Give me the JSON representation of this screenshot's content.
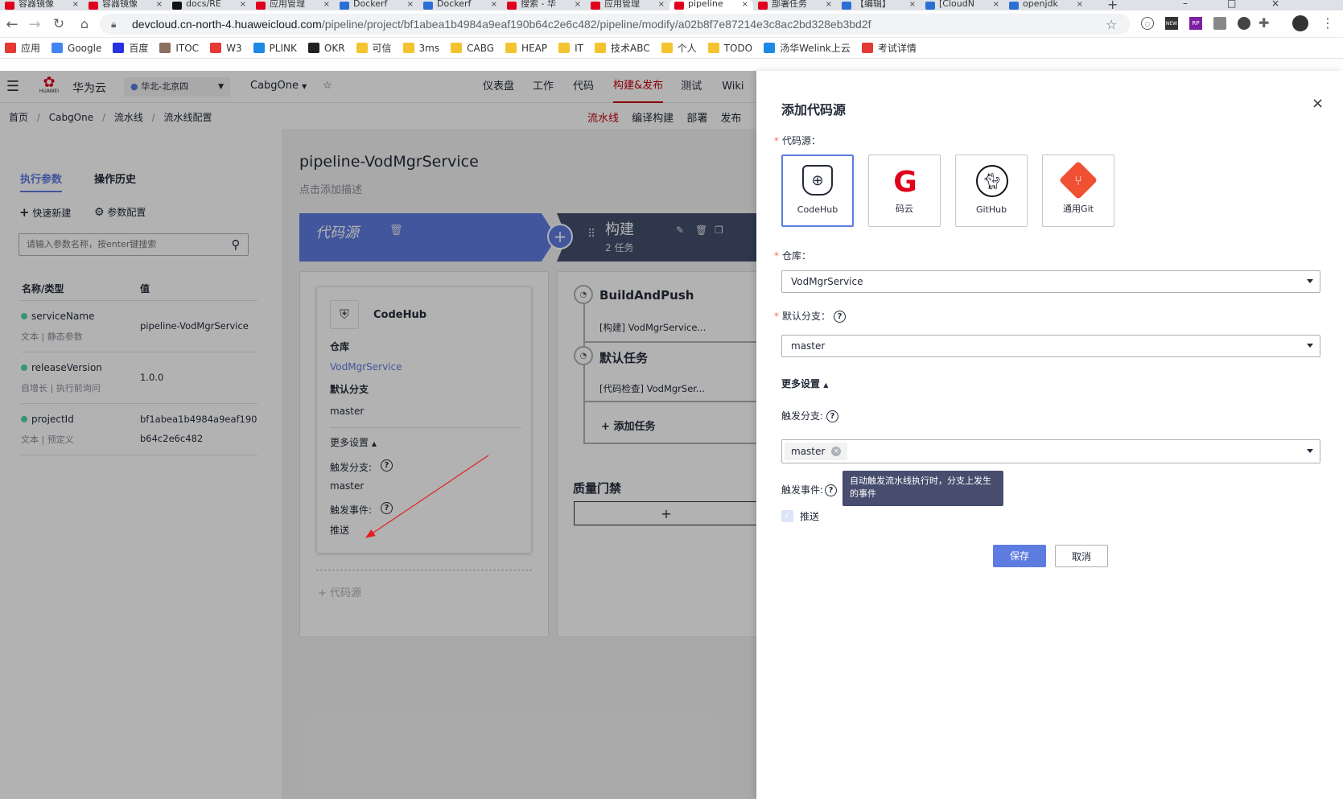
{
  "browser": {
    "tabs": [
      {
        "title": "容器镜像",
        "color": "#e0001b"
      },
      {
        "title": "容器镜像",
        "color": "#e0001b"
      },
      {
        "title": "docs/RE",
        "color": "#111111"
      },
      {
        "title": "应用管理",
        "color": "#e0001b"
      },
      {
        "title": "Dockerf",
        "color": "#2b6fd6"
      },
      {
        "title": "Dockerf",
        "color": "#2b6fd6"
      },
      {
        "title": "搜索 - 华",
        "color": "#e0001b"
      },
      {
        "title": "应用管理",
        "color": "#e0001b"
      },
      {
        "title": "pipeline",
        "color": "#e0001b"
      },
      {
        "title": "部署任务",
        "color": "#e0001b"
      },
      {
        "title": "【编辑】",
        "color": "#2b6fd6"
      },
      {
        "title": "[CloudN",
        "color": "#2b6fd6"
      },
      {
        "title": "openjdk",
        "color": "#2b6fd6"
      }
    ],
    "url_host": "devcloud.cn-north-4.huaweicloud.com",
    "url_path": "/pipeline/project/bf1abea1b4984a9eaf190b64c2e6c482/pipeline/modify/a02b8f7e87214e3c8ac2bd328eb3bd2f",
    "bookmarks": [
      {
        "label": "应用",
        "color": "#e53935"
      },
      {
        "label": "Google",
        "color": "#4285f4"
      },
      {
        "label": "百度",
        "color": "#2932e1"
      },
      {
        "label": "ITOC",
        "color": "#8d6e63"
      },
      {
        "label": "W3",
        "color": "#e53935"
      },
      {
        "label": "PLINK",
        "color": "#1e88e5"
      },
      {
        "label": "OKR",
        "color": "#212121"
      },
      {
        "label": "可信",
        "color": "#f4c430"
      },
      {
        "label": "3ms",
        "color": "#f4c430"
      },
      {
        "label": "CABG",
        "color": "#f4c430"
      },
      {
        "label": "HEAP",
        "color": "#f4c430"
      },
      {
        "label": "IT",
        "color": "#f4c430"
      },
      {
        "label": "技术ABC",
        "color": "#f4c430"
      },
      {
        "label": "个人",
        "color": "#f4c430"
      },
      {
        "label": "TODO",
        "color": "#f4c430"
      },
      {
        "label": "汤华Welink上云",
        "color": "#1e88e5"
      },
      {
        "label": "考试详情",
        "color": "#e53935"
      }
    ]
  },
  "app": {
    "brand": "华为云",
    "logo_text": "HUAWEI",
    "region": "华北-北京四",
    "project": "CabgOne",
    "nav": [
      "仪表盘",
      "工作",
      "代码",
      "构建&发布",
      "测试",
      "Wiki"
    ],
    "breadcrumb": [
      "首页",
      "CabgOne",
      "流水线",
      "流水线配置"
    ],
    "subnav": [
      "流水线",
      "编译构建",
      "部署",
      "发布"
    ]
  },
  "left": {
    "tabs": [
      "执行参数",
      "操作历史"
    ],
    "quick_new": "快速新建",
    "param_config": "参数配置",
    "search_placeholder": "请输入参数名称，按enter键搜索",
    "col_name": "名称/类型",
    "col_value": "值",
    "params": [
      {
        "name": "serviceName",
        "type": "文本 | 静态参数",
        "value": "pipeline-VodMgrService"
      },
      {
        "name": "releaseVersion",
        "type": "自增长 | 执行前询问",
        "value": "1.0.0"
      },
      {
        "name": "projectId",
        "type": "文本 | 预定义",
        "value": "bf1abea1b4984a9eaf190",
        "value2": "b64c2e6c482"
      }
    ]
  },
  "pipeline": {
    "title": "pipeline-VodMgrService",
    "desc": "点击添加描述",
    "stage1": "代码源",
    "stage2": "构建",
    "stage2_count": "2 任务",
    "source_card": {
      "title": "CodeHub",
      "repo_label": "仓库",
      "repo": "VodMgrService",
      "branch_label": "默认分支",
      "branch": "master",
      "more": "更多设置",
      "trigger_branch_label": "触发分支:",
      "trigger_branch": "master",
      "trigger_event_label": "触发事件:",
      "trigger_event": "推送"
    },
    "add_source": "代码源",
    "jobs": [
      {
        "name": "BuildAndPush",
        "task": "[构建] VodMgrService..."
      },
      {
        "name": "默认任务",
        "task": "[代码检查] VodMgrSer..."
      }
    ],
    "add_task": "添加任务",
    "quality_gate": "质量门禁"
  },
  "drawer": {
    "title": "添加代码源",
    "source_label": "代码源：",
    "sources": [
      "CodeHub",
      "码云",
      "GitHub",
      "通用Git"
    ],
    "repo_label": "仓库：",
    "repo_value": "VodMgrService",
    "branch_label": "默认分支：",
    "branch_value": "master",
    "more_settings": "更多设置",
    "trigger_branch_label": "触发分支:",
    "trigger_branch_tag": "master",
    "trigger_event_label": "触发事件:",
    "tooltip": "自动触发流水线执行时，分支上发生的事件",
    "push_label": "推送",
    "save": "保存",
    "cancel": "取消"
  }
}
